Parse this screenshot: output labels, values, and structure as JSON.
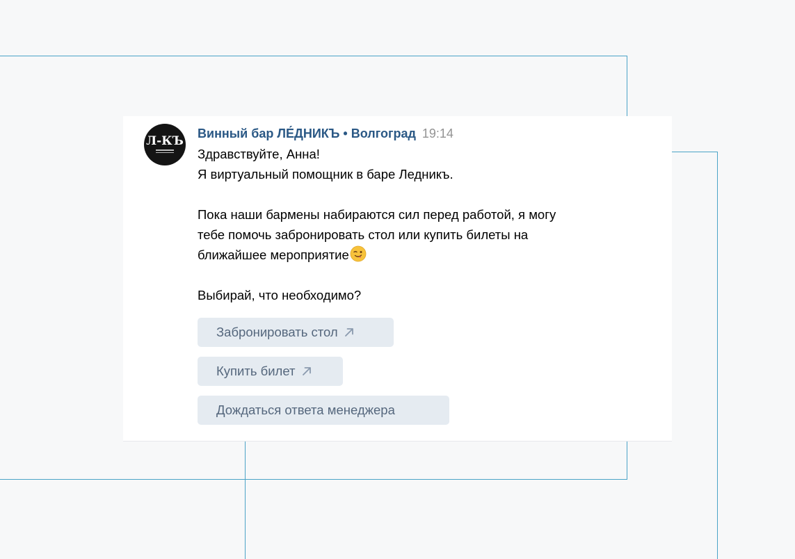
{
  "message": {
    "sender": "Винный бар ЛЕ́ДНИКЪ • Волгоград",
    "time": "19:14",
    "lines": [
      "Здравствуйте, Анна!",
      "Я виртуальный помощник в баре Ледникъ.",
      "",
      "Пока наши бармены набираются сил перед работой, я могу",
      "тебе помочь забронировать стол или купить билеты на",
      "ближайшее мероприятие",
      "",
      "Выбирай, что необходимо?"
    ],
    "emoji": "winking-face-with-tongue-icon"
  },
  "avatar": {
    "mark": "Л-КЪ"
  },
  "buttons": {
    "book_table": "Забронировать стол",
    "buy_ticket": "Купить билет",
    "wait_manager": "Дождаться ответа менеджера"
  },
  "colors": {
    "sender": "#2a5885",
    "time": "#939393",
    "button_bg": "#e5ebf1",
    "button_text": "#55677d",
    "guide_lines": "#4aa3c7",
    "background": "#f7f8f9"
  }
}
